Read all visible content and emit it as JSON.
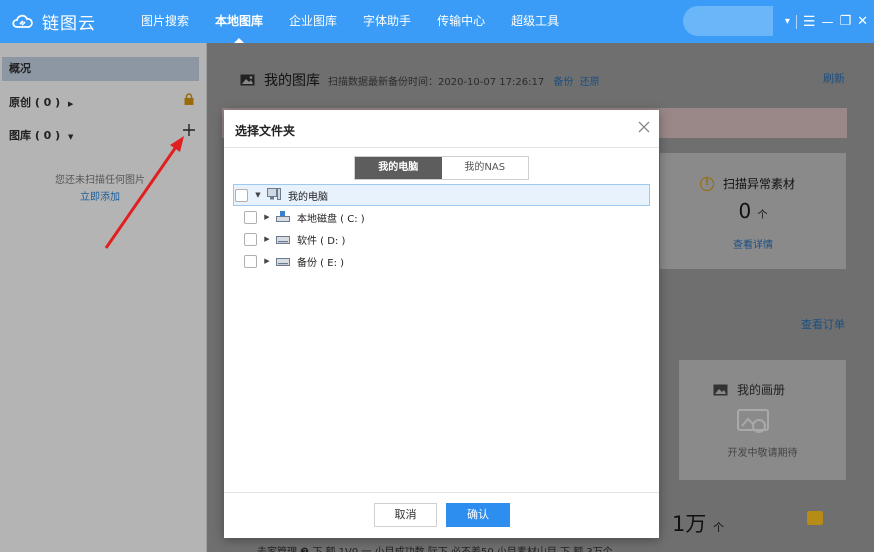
{
  "app": {
    "logo_text": "链图云"
  },
  "nav": {
    "items": [
      {
        "label": "图片搜索"
      },
      {
        "label": "本地图库"
      },
      {
        "label": "企业图库"
      },
      {
        "label": "字体助手"
      },
      {
        "label": "传输中心"
      },
      {
        "label": "超级工具"
      }
    ],
    "active_index": 1
  },
  "window_controls": {
    "dropdown": "▾",
    "menu": "☰",
    "minimize": "—",
    "maximize": "❐",
    "close": "✕"
  },
  "sidebar": {
    "overview": "概况",
    "original": "原创 ( 0 )",
    "library": "图库 ( 0 )",
    "empty_text": "您还未扫描任何图片",
    "add_link": "立即添加"
  },
  "main": {
    "title": "我的图库",
    "scan_info": "扫描数据最新备份时间：2020-10-07 17:26:17",
    "backup": "备份",
    "restore": "还原",
    "refresh": "刷新",
    "abnormal_title": "扫描异常素材",
    "abnormal_count": "0",
    "abnormal_unit": "个",
    "abnormal_link": "查看详情",
    "order_link": "查看订单",
    "album_title": "我的画册",
    "album_status": "开发中敬请期待",
    "big_stat": "1万",
    "big_stat_unit": "个",
    "bottom_text": "去家管理 ❷        下  额 1V0        一    小目成功数       际下  必不差50            小目素材山目          下  额 3万个"
  },
  "dialog": {
    "title": "选择文件夹",
    "tabs": [
      {
        "label": "我的电脑"
      },
      {
        "label": "我的NAS"
      }
    ],
    "tree": [
      {
        "label": "我的电脑",
        "expanded": true,
        "selected": true
      },
      {
        "label": "本地磁盘 ( C: )"
      },
      {
        "label": "软件 ( D: )"
      },
      {
        "label": "备份 ( E: )"
      }
    ],
    "cancel": "取消",
    "confirm": "确认"
  },
  "colors": {
    "brand_blue": "#3a9cf7",
    "confirm_blue": "#2e8ef0",
    "arrow_red": "#e02020"
  }
}
